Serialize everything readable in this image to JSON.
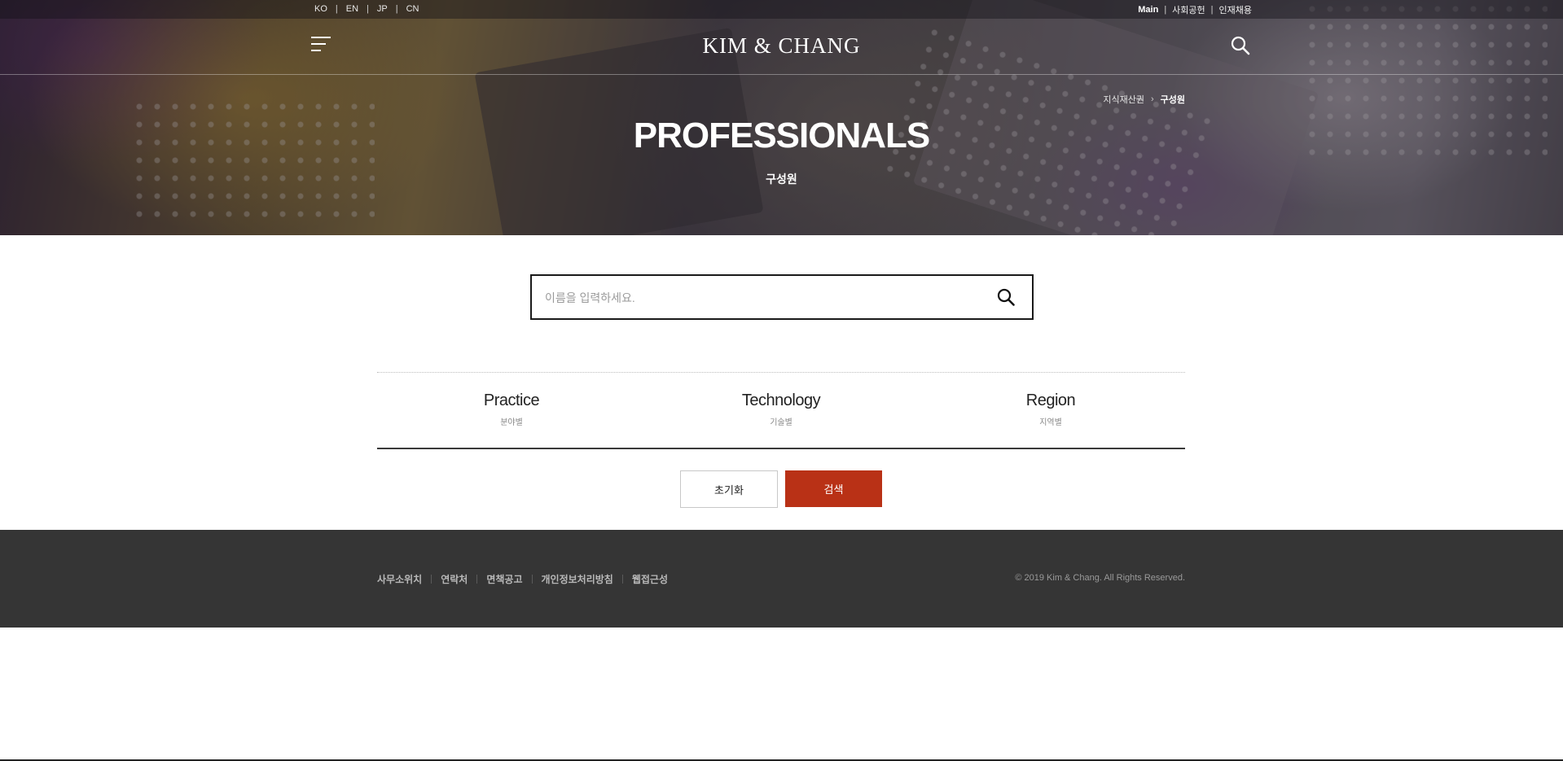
{
  "header": {
    "languages": [
      "KO",
      "EN",
      "JP",
      "CN"
    ],
    "top_links": [
      "Main",
      "사회공헌",
      "인재채용"
    ],
    "logo": "KIM & CHANG",
    "breadcrumb": [
      "지식재산권",
      "구성원"
    ],
    "title": "PROFESSIONALS",
    "subtitle": "구성원"
  },
  "search": {
    "placeholder": "이름을 입력하세요.",
    "value": ""
  },
  "filters": [
    {
      "label": "Practice",
      "sublabel": "분야별"
    },
    {
      "label": "Technology",
      "sublabel": "기술별"
    },
    {
      "label": "Region",
      "sublabel": "지역별"
    }
  ],
  "buttons": {
    "reset": "초기화",
    "search": "검색"
  },
  "footer": {
    "links": [
      "사무소위치",
      "연락처",
      "면책공고",
      "개인정보처리방침",
      "웹접근성"
    ],
    "copyright": "© 2019 Kim & Chang. All Rights Reserved."
  },
  "colors": {
    "accent": "#b93116",
    "footer_bg": "#353535"
  },
  "icons": [
    "menu-icon",
    "search-icon"
  ]
}
